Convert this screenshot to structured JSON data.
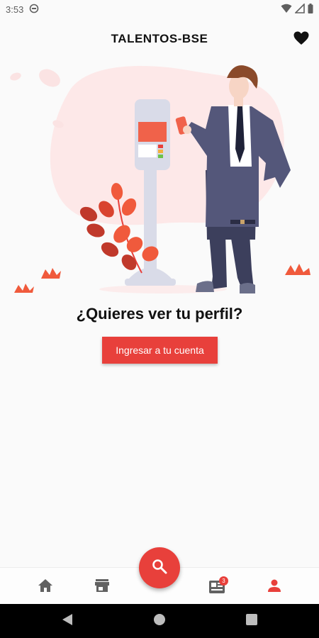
{
  "status_bar": {
    "time": "3:53"
  },
  "app_bar": {
    "title": "TALENTOS-BSE"
  },
  "main": {
    "prompt": "¿Quieres ver tu perfil?",
    "login_label": "Ingresar a tu cuenta"
  },
  "bottom_nav": {
    "items": [
      "home-icon",
      "store-icon",
      "search-icon",
      "news-icon",
      "person-icon"
    ],
    "news_badge": "3",
    "active_item": "person-icon"
  },
  "colors": {
    "accent": "#e8403b",
    "background": "#fafafa",
    "blob": "#fde8e8"
  }
}
